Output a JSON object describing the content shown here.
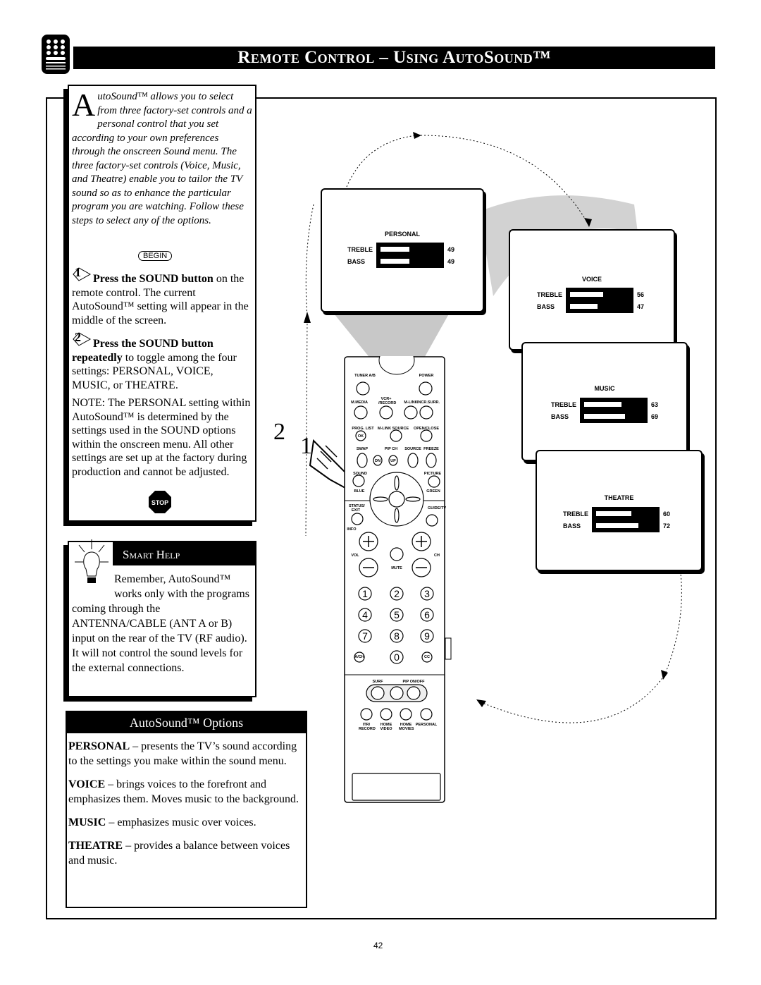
{
  "header": {
    "title": "Remote Control – Using AutoSound™"
  },
  "intro": {
    "dropcap": "A",
    "text": "utoSound™ allows you to select from three factory-set controls and a personal control that you set according to your own preferences through the onscreen Sound menu. The three factory-set controls (Voice, Music, and Theatre) enable you to tailor the TV sound so as to enhance the particular program you are watching. Follow these steps to select any of the options."
  },
  "begin_label": "BEGIN",
  "steps": [
    {
      "number": "1",
      "bold": "Press the SOUND button",
      "text": " on the remote control.  The current AutoSound™ setting will appear in the middle of the screen."
    },
    {
      "number": "2",
      "bold": "Press the SOUND button repeatedly",
      "text": " to toggle among the four settings: PERSONAL, VOICE, MUSIC, or THEATRE."
    }
  ],
  "note": "NOTE:  The PERSONAL setting within AutoSound™ is determined by the settings used in the SOUND options within the onscreen menu. All other settings are set up at the factory during production and cannot be adjusted.",
  "stop_label": "STOP",
  "smart_help": {
    "title": "Smart Help",
    "text": "Remember, AutoSound™ works only with the programs coming through the ANTENNA/CABLE (ANT A or B) input on the rear of the TV (RF audio).  It will not control the sound levels for the external connections."
  },
  "options": {
    "title": "AutoSound™ Options",
    "items": [
      {
        "name": "PERSONAL",
        "text": " – presents the TV’s sound according to the settings you make within the sound menu."
      },
      {
        "name": "VOICE",
        "text": " – brings voices to the forefront and emphasizes them. Moves music to the background."
      },
      {
        "name": "MUSIC",
        "text": " – emphasizes music over voices."
      },
      {
        "name": "THEATRE",
        "text": " – provides a balance between voices and music."
      }
    ]
  },
  "screens": [
    {
      "title": "PERSONAL",
      "treble_label": "TREBLE",
      "treble": 49,
      "bass_label": "BASS",
      "bass": 49
    },
    {
      "title": "VOICE",
      "treble_label": "TREBLE",
      "treble": 56,
      "bass_label": "BASS",
      "bass": 47
    },
    {
      "title": "MUSIC",
      "treble_label": "TREBLE",
      "treble": 63,
      "bass_label": "BASS",
      "bass": 69
    },
    {
      "title": "THEATRE",
      "treble_label": "TREBLE",
      "treble": 60,
      "bass_label": "BASS",
      "bass": 72
    }
  ],
  "callouts": {
    "step2": "2",
    "step1": "1"
  },
  "remote": {
    "tuner": "TUNER A/B",
    "power": "POWER",
    "mmedia": "M.MEDIA",
    "vcr_record": "VCR+ /RECORD",
    "mlink": "M-LINK",
    "incr_surr": "INCR.SURR.",
    "prog_list": "PROG. LIST",
    "ok": "OK",
    "mlink_source": "M-LINK SOURCE",
    "open_close": "OPEN/CLOSE",
    "swap": "SWAP",
    "pip_ch": "PIP CH",
    "on": "DN",
    "up": "UP",
    "source": "SOURCE",
    "freeze": "FREEZE",
    "sound": "SOUND",
    "picture": "PICTURE",
    "blue": "BLUE",
    "green": "GREEN",
    "status_exit": "STATUS/ EXIT",
    "guide_tv": "GUIDE/TV",
    "info": "INFO",
    "vol": "VOL",
    "ch": "CH",
    "mute": "MUTE",
    "digits": [
      "1",
      "2",
      "3",
      "4",
      "5",
      "6",
      "7",
      "8",
      "9",
      "0"
    ],
    "ach": "A/CH",
    "cc": "CC",
    "surf": "SURF",
    "pip_onoff": "PIP ON/OFF",
    "itr_record": "ITR/ RECORD",
    "home_video": "HOME VIDEO",
    "home_movies": "HOME MOVIES",
    "personal": "PERSONAL"
  },
  "page_number": "42"
}
